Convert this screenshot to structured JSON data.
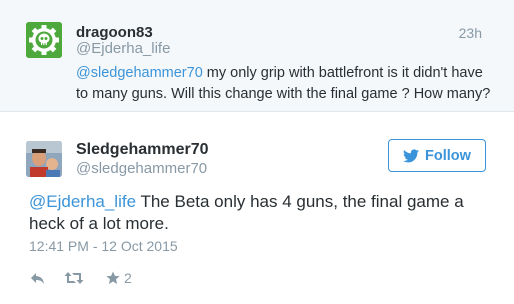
{
  "reply_tweet": {
    "author_name": "dragoon83",
    "author_handle": "@Ejderha_life",
    "time": "23h",
    "mention": "@sledgehammer70",
    "text": "  my only grip with battlefront is it didn't have to many guns. Will this change with the final game ? How many?"
  },
  "main_tweet": {
    "author_name": "Sledgehammer70",
    "author_handle": "@sledgehammer70",
    "follow_label": "Follow",
    "mention": "@Ejderha_life",
    "text": " The Beta only has 4 guns, the final game a heck of a lot more.",
    "timestamp": "12:41 PM - 12 Oct 2015",
    "favorite_count": "2"
  },
  "colors": {
    "link": "#3b94d9",
    "muted": "#8899a6",
    "text": "#292f33",
    "reply_bg": "#f5f8fa",
    "avatar_green": "#4ea93c"
  },
  "icons": [
    "skull-gear-avatar",
    "twitter-bird-icon",
    "reply-icon",
    "retweet-icon",
    "star-icon"
  ]
}
